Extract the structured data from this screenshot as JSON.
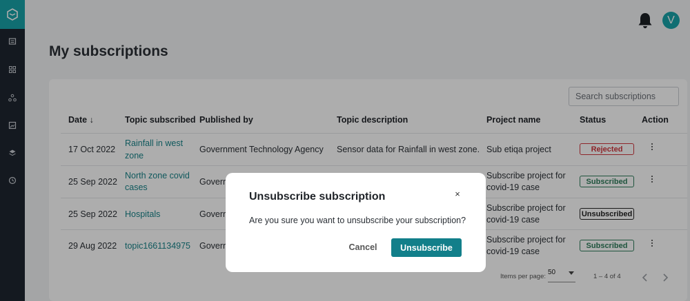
{
  "sidebar": {
    "logo_icon": "app-logo-icon",
    "items": [
      {
        "icon": "catalog-icon"
      },
      {
        "icon": "dashboard-grid-icon"
      },
      {
        "icon": "network-icon"
      },
      {
        "icon": "image-icon"
      },
      {
        "icon": "layers-icon"
      },
      {
        "icon": "clock-icon"
      }
    ]
  },
  "header": {
    "notification_icon": "bell-icon",
    "avatar_initial": "V"
  },
  "page": {
    "title": "My subscriptions"
  },
  "search": {
    "placeholder": "Search subscriptions"
  },
  "table": {
    "columns": [
      "Date ↓",
      "Topic subscribed",
      "Published by",
      "Topic description",
      "Project name",
      "Status",
      "Action"
    ],
    "rows": [
      {
        "date": "17 Oct 2022",
        "topic_line1": "Rainfall in west",
        "topic_line2": "zone",
        "publisher": "Government Technology Agency",
        "description": "Sensor data for Rainfall in west zone.",
        "project_line1": "Sub etiqa project",
        "project_line2": "",
        "status": "Rejected"
      },
      {
        "date": "25 Sep 2022",
        "topic_line1": "North zone covid",
        "topic_line2": "cases",
        "publisher": "Govern",
        "description": "",
        "project_line1": "Subscribe project for",
        "project_line2": "covid-19 case",
        "status": "Subscribed"
      },
      {
        "date": "25 Sep 2022",
        "topic_line1": "Hospitals",
        "topic_line2": "",
        "publisher": "Govern",
        "description": "",
        "project_line1": "Subscribe project for",
        "project_line2": "covid-19 case",
        "status": "Unsubscribed"
      },
      {
        "date": "29 Aug 2022",
        "topic_line1": "topic1661134975",
        "topic_line2": "",
        "publisher": "Govern",
        "description": "",
        "project_line1": "Subscribe project for",
        "project_line2": "covid-19 case",
        "status": "Subscribed"
      }
    ]
  },
  "pagination": {
    "items_per_page_label": "Items per page:",
    "items_per_page_value": "50",
    "range": "1 – 4 of 4"
  },
  "modal": {
    "title": "Unsubscribe subscription",
    "close_symbol": "×",
    "body": "Are you sure you want to unsubscribe your subscription?",
    "cancel_label": "Cancel",
    "confirm_label": "Unsubscribe"
  },
  "colors": {
    "accent": "#19a3a8",
    "primary_button": "#127f8a",
    "rejected": "#d0363d",
    "subscribed": "#2e7d5b",
    "unsubscribed": "#222222"
  }
}
